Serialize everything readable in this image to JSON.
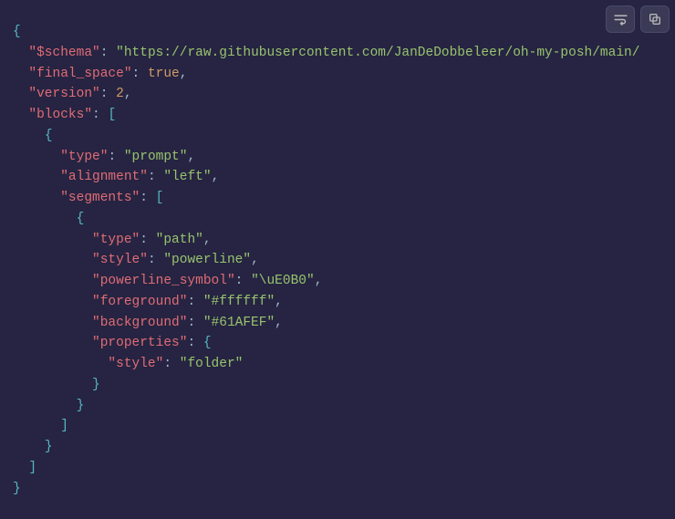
{
  "toolbar": {
    "wrap_icon": "wrap-lines-icon",
    "copy_icon": "copy-icon"
  },
  "code": {
    "root": {
      "schema_key": "\"$schema\"",
      "schema_val": "\"https://raw.githubusercontent.com/JanDeDobbeleer/oh-my-posh/main/",
      "final_space_key": "\"final_space\"",
      "final_space_val": "true",
      "version_key": "\"version\"",
      "version_val": "2",
      "blocks_key": "\"blocks\"",
      "block": {
        "type_key": "\"type\"",
        "type_val": "\"prompt\"",
        "alignment_key": "\"alignment\"",
        "alignment_val": "\"left\"",
        "segments_key": "\"segments\"",
        "segment": {
          "type_key": "\"type\"",
          "type_val": "\"path\"",
          "style_key": "\"style\"",
          "style_val": "\"powerline\"",
          "powerline_symbol_key": "\"powerline_symbol\"",
          "powerline_symbol_val": "\"\\uE0B0\"",
          "foreground_key": "\"foreground\"",
          "foreground_val": "\"#ffffff\"",
          "background_key": "\"background\"",
          "background_val": "\"#61AFEF\"",
          "properties_key": "\"properties\"",
          "properties": {
            "style_key": "\"style\"",
            "style_val": "\"folder\""
          }
        }
      }
    }
  }
}
